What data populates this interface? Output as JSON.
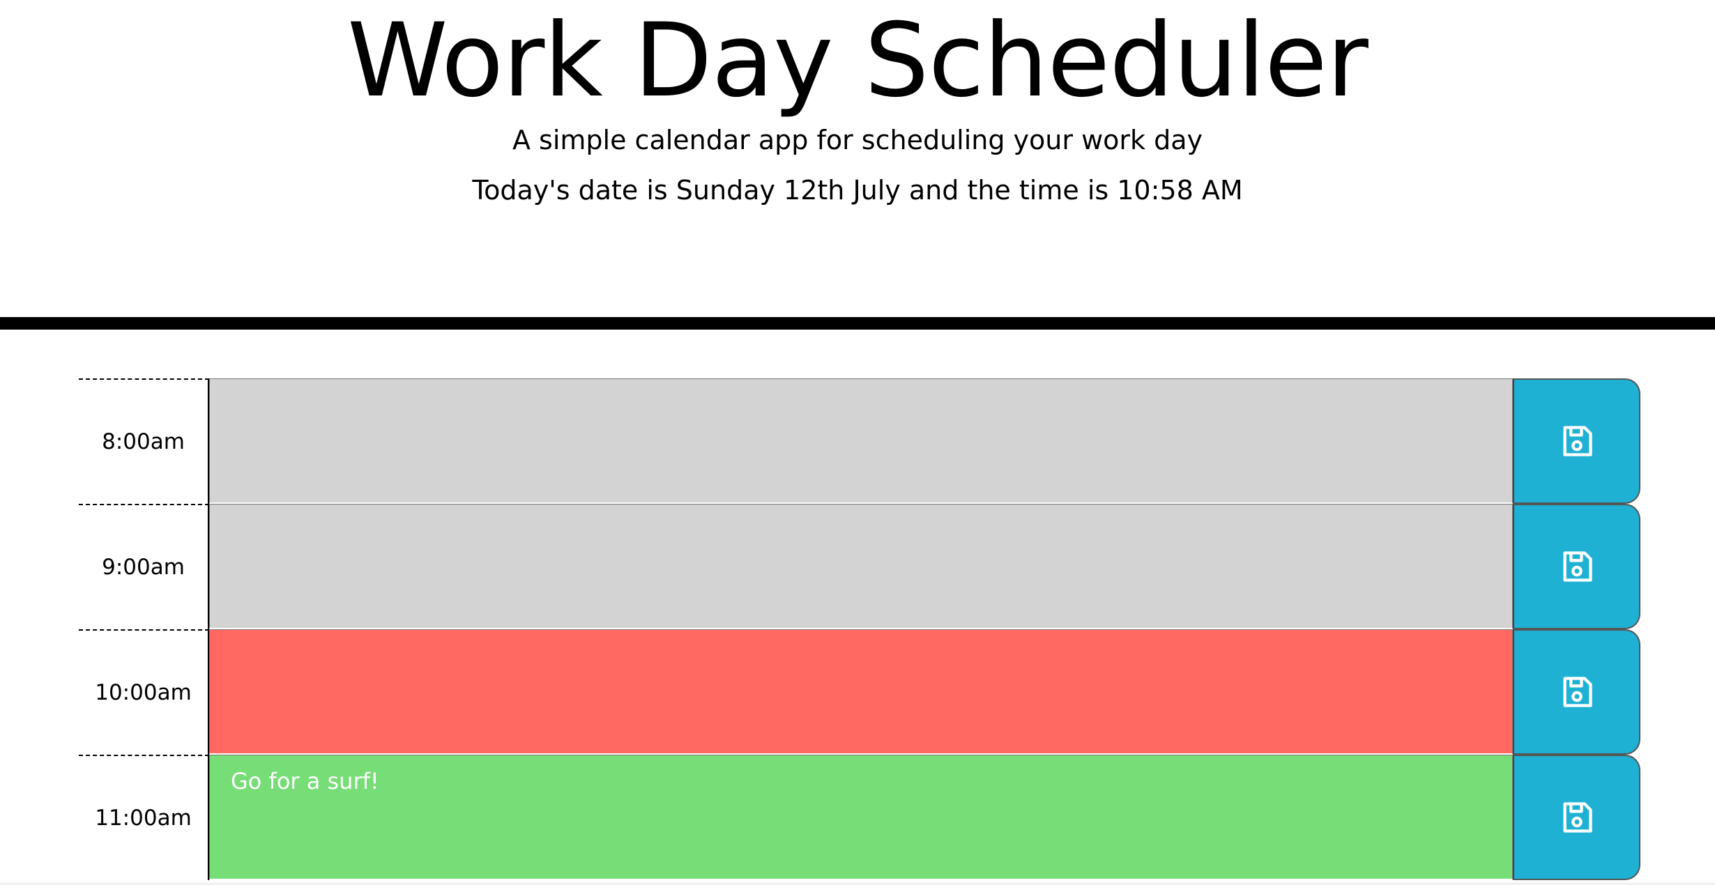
{
  "header": {
    "title": "Work Day Scheduler",
    "lead": "A simple calendar app for scheduling your work day",
    "current_day": "Today's date is Sunday 12th July and the time is 10:58 AM"
  },
  "colors": {
    "past": "#d3d3d3",
    "present": "#ff6961",
    "future": "#77dd77",
    "save_button": "#1fb1d4"
  },
  "timeblocks": [
    {
      "hour": "8:00am",
      "text": "",
      "state": "past",
      "save_icon": "save-icon"
    },
    {
      "hour": "9:00am",
      "text": "",
      "state": "past",
      "save_icon": "save-icon"
    },
    {
      "hour": "10:00am",
      "text": "",
      "state": "present",
      "save_icon": "save-icon"
    },
    {
      "hour": "11:00am",
      "text": "Go for a surf!",
      "state": "future",
      "save_icon": "save-icon"
    }
  ]
}
